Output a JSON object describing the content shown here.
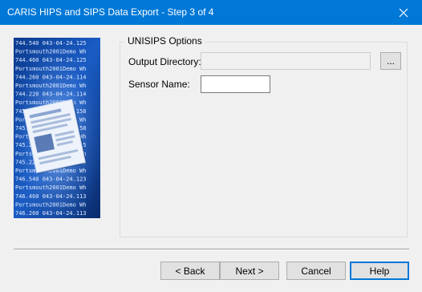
{
  "window": {
    "title": "CARIS HIPS and SIPS Data Export - Step 3 of 4",
    "close_icon": "close-icon",
    "accent_color": "#0078d7"
  },
  "banner": {
    "icon": "document-icon",
    "lines": [
      "744.540 043-04-24.125",
      "Portsmouth2001Demo Wh",
      "744.460 043-04-24.125",
      "Portsmouth2001Demo Wh",
      "744.260 043-04-24.114",
      "Portsmouth2001Demo Wh",
      "744.220 043-04-24.114",
      "Portsmouth2001Demo Wh",
      "745.540 043-04-24.158",
      "Portsmouth2001Demo Wh",
      "745.460 043-04-24.158",
      "Portsmouth2001Demo Wh",
      "745.260 043-04-24.115",
      "Portsmouth2001Demo Wh",
      "745.220 043-04-24.145",
      "Portsmouth2001Demo Wh",
      "746.540 043-04-24.123",
      "Portsmouth2001Demo Wh",
      "746.460 043-04-24.113",
      "Portsmouth2001Demo Wh",
      "746.260 043-04-24.113"
    ]
  },
  "options": {
    "group_label": "UNISIPS Options",
    "output_directory_label": "Output Directory:",
    "output_directory_value": "",
    "browse_label": "...",
    "sensor_name_label": "Sensor Name:",
    "sensor_name_value": ""
  },
  "buttons": {
    "back": "< Back",
    "next": "Next >",
    "cancel": "Cancel",
    "help": "Help"
  }
}
